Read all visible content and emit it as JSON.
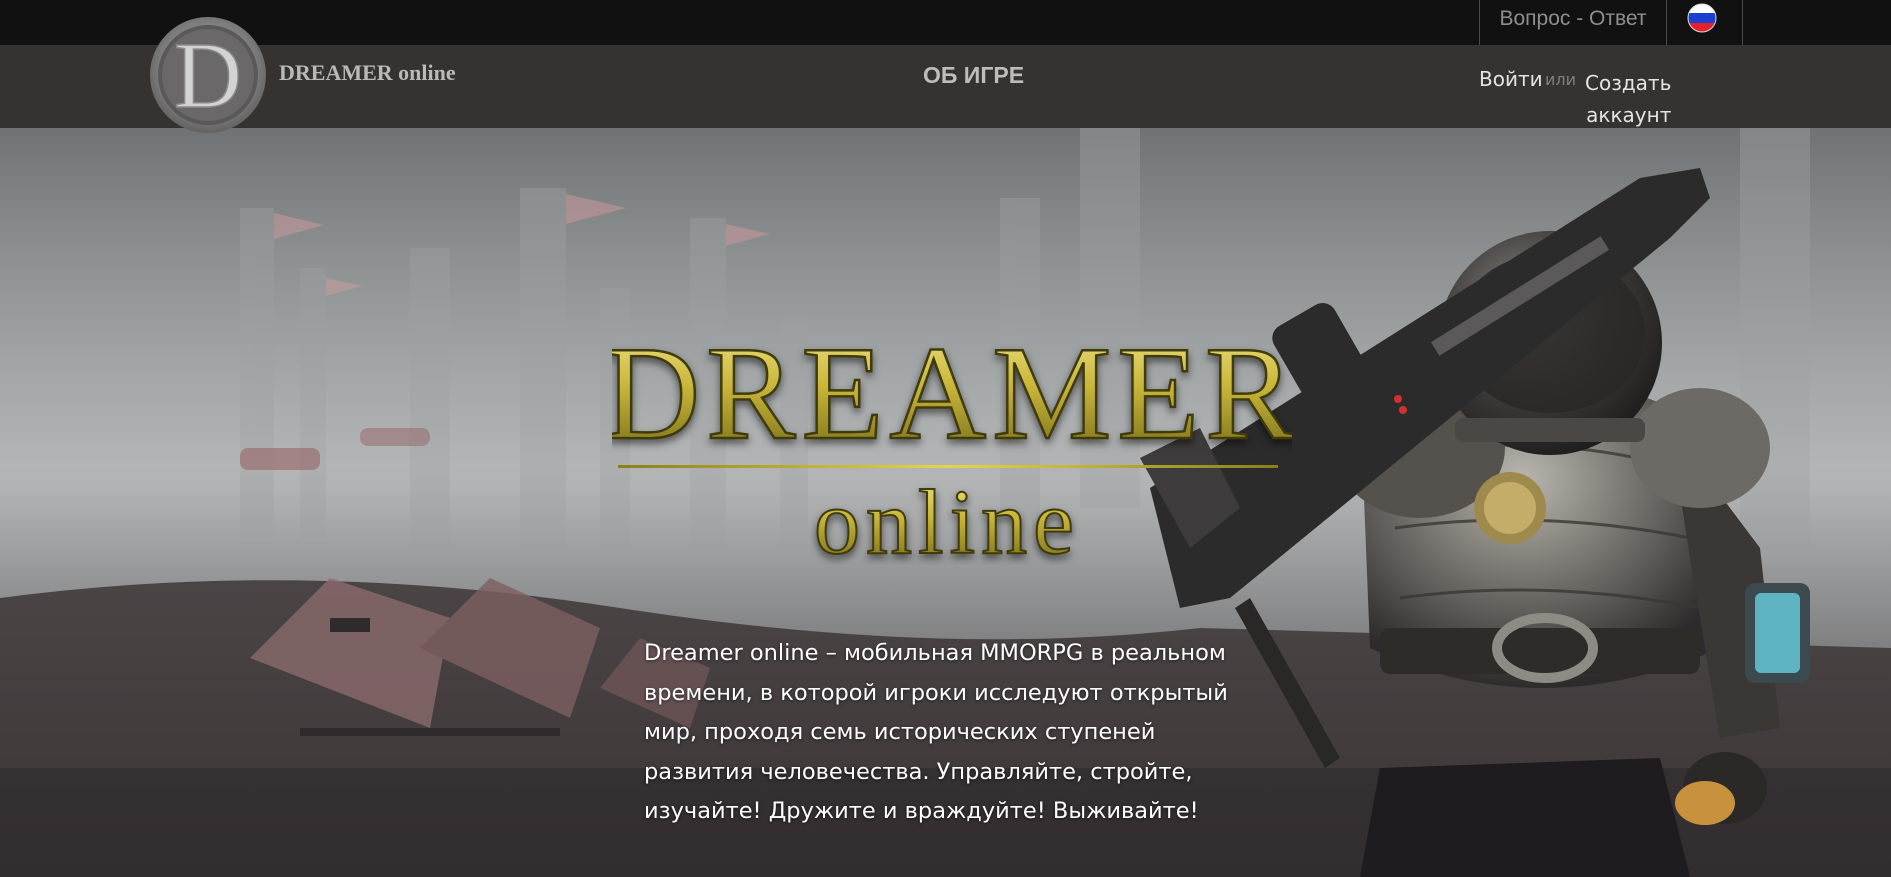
{
  "topbar": {
    "faq_label": "Вопрос - Ответ",
    "language_flag": "russia-flag-icon"
  },
  "navbar": {
    "logo_icon": "dreamer-d-logo-icon",
    "brand": "DREAMER online",
    "about_label": "ОБ ИГРЕ",
    "login_label": "Войти",
    "or_label": "или",
    "register_label_line1": "Создать",
    "register_label_line2": "аккаунт"
  },
  "hero": {
    "title_main": "DREAMER",
    "title_sub": "online",
    "description": "Dreamer online – мобильная MMORPG в реальном времени, в которой игроки исследуют открытый мир, проходя семь исторических ступеней развития человечества. Управляйте, стройте, изучайте! Дружите и враждуйте! Выживайте!",
    "character_icon": "armored-astronaut-soldier-illustration"
  },
  "colors": {
    "topbar_bg": "#111112",
    "navbar_bg": "#363232",
    "gold": "#d6c63a"
  }
}
